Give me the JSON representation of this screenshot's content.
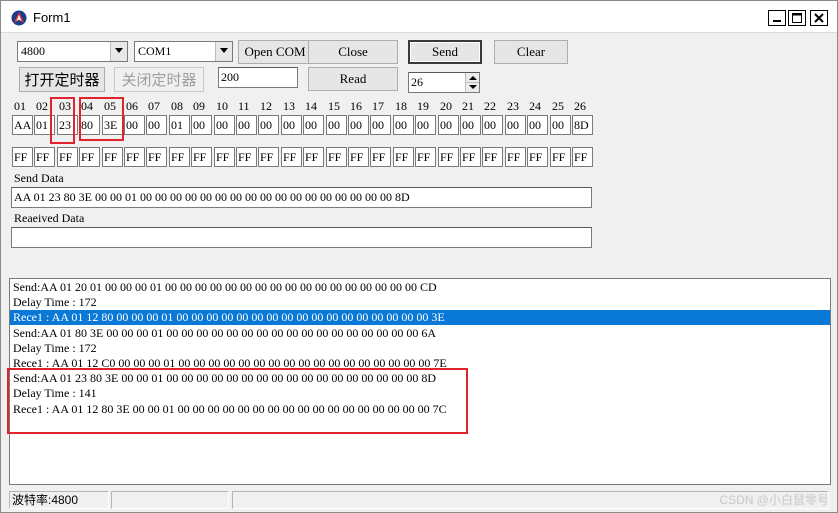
{
  "window": {
    "title": "Form1"
  },
  "toolbar": {
    "baud_value": "4800",
    "port_value": "COM1",
    "open_com_label": "Open COM",
    "close_label": "Close",
    "send_label": "Send",
    "clear_label": "Clear",
    "open_timer_label": "打开定时器",
    "close_timer_label": "关闭定时器",
    "interval_value": "200",
    "read_label": "Read",
    "count_value": "26"
  },
  "columns": [
    "01",
    "02",
    "03",
    "04",
    "05",
    "06",
    "07",
    "08",
    "09",
    "10",
    "11",
    "12",
    "13",
    "14",
    "15",
    "16",
    "17",
    "18",
    "19",
    "20",
    "21",
    "22",
    "23",
    "24",
    "25",
    "26"
  ],
  "send_bytes": [
    "AA",
    "01",
    "23",
    "80",
    "3E",
    "00",
    "00",
    "01",
    "00",
    "00",
    "00",
    "00",
    "00",
    "00",
    "00",
    "00",
    "00",
    "00",
    "00",
    "00",
    "00",
    "00",
    "00",
    "00",
    "00",
    "8D"
  ],
  "recv_bytes": [
    "FF",
    "FF",
    "FF",
    "FF",
    "FF",
    "FF",
    "FF",
    "FF",
    "FF",
    "FF",
    "FF",
    "FF",
    "FF",
    "FF",
    "FF",
    "FF",
    "FF",
    "FF",
    "FF",
    "FF",
    "FF",
    "FF",
    "FF",
    "FF",
    "FF",
    "FF"
  ],
  "send_data": {
    "label": "Send Data",
    "value": "AA 01 23 80 3E 00 00 01 00 00 00 00 00 00 00 00 00 00 00 00 00 00 00 00 00 8D"
  },
  "received_data": {
    "label": "Reaeived Data",
    "value": ""
  },
  "log": [
    "Send:AA 01 20 01 00 00 00 01 00 00 00 00 00 00 00 00 00 00 00 00 00 00 00 00 00 CD",
    "Delay Time : 172",
    "Rece1 :  AA 01 12 80 00 00 00 01 00 00 00 00 00 00 00 00 00 00 00 00 00 00 00 00 00 3E",
    "Send:AA 01 80 3E 00 00 00 01 00 00 00 00 00 00 00 00 00 00 00 00 00 00 00 00 00 6A",
    "Delay Time : 172",
    "Rece1 :  AA 01 12 C0 00 00 00 01 00 00 00 00 00 00 00 00 00 00 00 00 00 00 00 00 00 7E",
    "Send:AA 01 23 80 3E 00 00 01 00 00 00 00 00 00 00 00 00 00 00 00 00 00 00 00 00 8D",
    "Delay Time : 141",
    "Rece1 :  AA 01 12 80 3E 00 00 01 00 00 00 00 00 00 00 00 00 00 00 00 00 00 00 00 00 7C"
  ],
  "status": {
    "baud_text": "波特率:4800",
    "panel2": "",
    "panel3": ""
  },
  "watermark": "CSDN @小白鼠零号",
  "colors": {
    "selection": "#0a78d7",
    "annotation": "#e0242b"
  }
}
